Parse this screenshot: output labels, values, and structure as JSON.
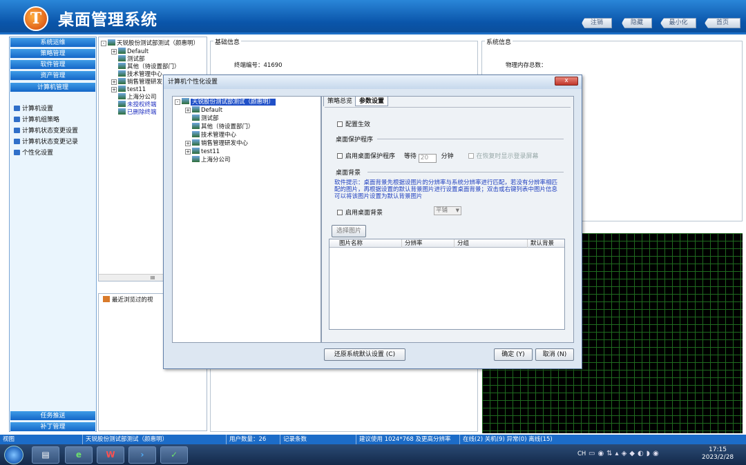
{
  "app": {
    "title": "桌面管理系统",
    "logo": "T"
  },
  "topbar": {
    "buttons": [
      "注销",
      "隐藏",
      "最小化",
      "首页"
    ]
  },
  "nav": {
    "top_buttons": [
      "系统运维",
      "策略管理",
      "软件管理",
      "资产管理",
      "计算机管理"
    ],
    "items": [
      "计算机设置",
      "计算机组策略",
      "计算机状态变更设置",
      "计算机状态变更记录",
      "个性化设置"
    ],
    "bottom_buttons": [
      "任务推送",
      "补丁管理"
    ]
  },
  "tree": {
    "root": "天锐股份测试部测试（颜惠明）",
    "items": [
      "Default",
      "测试部",
      "其他（待设置部门）",
      "技术管理中心",
      "销售管理研发",
      "test11",
      "上海分公司",
      "未授权终端",
      "已删除终端"
    ],
    "scroll_mark": "III"
  },
  "recent": {
    "label": "最近浏览过的视"
  },
  "basic": {
    "title": "基础信息",
    "terminal_label": "终端编号：",
    "terminal_no": "41690"
  },
  "sysinfo": {
    "title": "系统信息",
    "mem_label": "物理内存总数："
  },
  "dialog": {
    "title": "计算机个性化设置",
    "close": "x",
    "tree_root": "天锐股份测试部测试（颜惠明）",
    "tree_items": [
      "Default",
      "测试部",
      "其他（待设置部门）",
      "技术管理中心",
      "销售管理研发中心",
      "test11",
      "上海分公司"
    ],
    "tabs": [
      "策略总览",
      "参数设置"
    ],
    "enable_config": "配置生效",
    "screensaver_title": "桌面保护程序",
    "screensaver_enable": "启用桌面保护程序",
    "wait_label": "等待",
    "wait_value": "20",
    "minutes": "分钟",
    "show_login": "在恢复时显示登录屏幕",
    "bg_title": "桌面背景",
    "hint": "软件提示：桌面背景先根据设图片的分辨率与系统分辨率进行匹配，若没有分辨率相匹配的图片，再根据设置的默认背景图片进行设置桌面背景；双击或右键列表中图片信息可以将该图片设置为默认背景图片",
    "bg_enable": "启用桌面背景",
    "bg_mode": "平铺",
    "choose_image": "选择图片",
    "table_headers": [
      "图片名称",
      "分辨率",
      "分组",
      "默认背景"
    ],
    "restore": "还原系统默认设置 (C)",
    "ok": "确定 (Y)",
    "cancel": "取消 (N)"
  },
  "status": {
    "view": "视图",
    "org": "天锐股份测试部测试（颜惠明）",
    "users_label": "用户数量：",
    "users": "26",
    "records": "记录条数",
    "suggest": "建议使用 1024*768 及更高分辨率",
    "online": "在线(2) 关机(9) 异常(0) 离线(15)"
  },
  "taskbar": {
    "time": "17:15",
    "date": "2023/2/28",
    "lang": "CH"
  },
  "colors": {
    "nav_blue": "#1467c8",
    "title_blue": "#0a55aa",
    "hint_blue": "#1f3fbf"
  }
}
